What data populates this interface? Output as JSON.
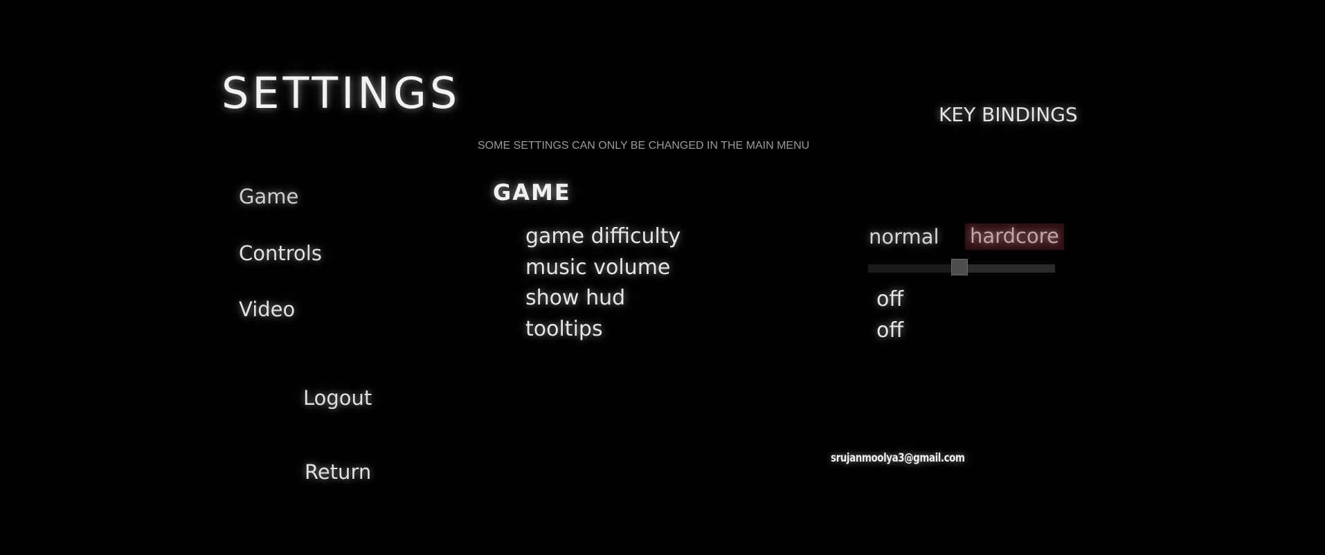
{
  "header": {
    "title": "SETTINGS",
    "key_bindings_label": "KEY BINDINGS",
    "notice": "SOME SETTINGS CAN ONLY BE CHANGED IN THE MAIN MENU"
  },
  "nav": {
    "game": "Game",
    "controls": "Controls",
    "video": "Video",
    "logout": "Logout",
    "return": "Return"
  },
  "section": {
    "title": "GAME",
    "rows": {
      "difficulty": {
        "label": "game difficulty",
        "options": [
          "normal",
          "hardcore"
        ],
        "selected": "hardcore"
      },
      "music_volume": {
        "label": "music volume",
        "level": 0.49
      },
      "show_hud": {
        "label": "show hud",
        "value": "off"
      },
      "tooltips": {
        "label": "tooltips",
        "value": "off"
      }
    }
  },
  "footer": {
    "email": "srujanmoolya3@gmail.com"
  },
  "colors": {
    "background": "#000000",
    "text": "#e6e6e6",
    "muted": "#9a9a9a",
    "selected_bg": "#2e0e0f",
    "selected_text": "#c9a3a3"
  }
}
